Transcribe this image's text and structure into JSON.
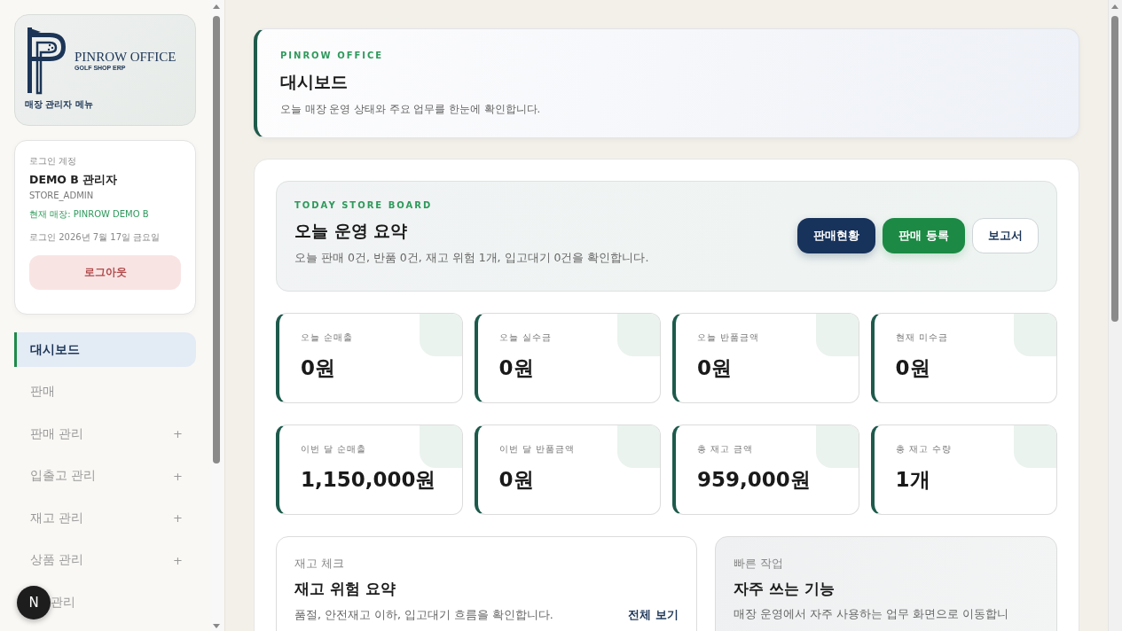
{
  "sidebar": {
    "logo": {
      "title": "PINROW OFFICE",
      "subtitle": "GOLF SHOP ERP",
      "caption": "매장 관리자 메뉴"
    },
    "account": {
      "label": "로그인 계정",
      "name": "DEMO B 관리자",
      "role": "STORE_ADMIN",
      "store": "현재 매장: PINROW DEMO B",
      "login_date": "로그인 2026년 7월 17일 금요일",
      "logout": "로그아웃"
    },
    "items": [
      {
        "label": "대시보드",
        "selected": true
      },
      {
        "label": "판매",
        "selected": false
      },
      {
        "label": "판매 관리",
        "selected": false,
        "toggle": "+"
      },
      {
        "label": "입출고 관리",
        "selected": false,
        "toggle": "+"
      },
      {
        "label": "재고 관리",
        "selected": false,
        "toggle": "+"
      },
      {
        "label": "상품 관리",
        "selected": false,
        "toggle": "+"
      },
      {
        "label": "관리",
        "selected": false,
        "covered": true
      }
    ],
    "floating_badge": "N"
  },
  "header": {
    "eyebrow": "PINROW OFFICE",
    "title": "대시보드",
    "description": "오늘 매장 운영 상태와 주요 업무를 한눈에 확인합니다."
  },
  "board": {
    "eyebrow": "TODAY STORE BOARD",
    "title": "오늘 운영 요약",
    "description": "오늘 판매 0건, 반품 0건, 재고 위험 1개, 입고대기 0건을 확인합니다.",
    "buttons": [
      {
        "label": "판매현황",
        "kind": "navy"
      },
      {
        "label": "판매 등록",
        "kind": "green"
      },
      {
        "label": "보고서",
        "kind": "outline"
      }
    ]
  },
  "stats": [
    {
      "label": "오늘 순매출",
      "value": "0원"
    },
    {
      "label": "오늘 실수금",
      "value": "0원"
    },
    {
      "label": "오늘 반품금액",
      "value": "0원"
    },
    {
      "label": "현재 미수금",
      "value": "0원"
    },
    {
      "label": "이번 달 순매출",
      "value": "1,150,000원"
    },
    {
      "label": "이번 달 반품금액",
      "value": "0원"
    },
    {
      "label": "총 재고 금액",
      "value": "959,000원"
    },
    {
      "label": "총 재고 수량",
      "value": "1개"
    }
  ],
  "panels": [
    {
      "eyebrow": "재고 체크",
      "title": "재고 위험 요약",
      "description": "품절, 안전재고 이하, 입고대기 흐름을 확인합니다.",
      "link": "전체 보기",
      "kind": "plain"
    },
    {
      "eyebrow": "빠른 작업",
      "title": "자주 쓰는 기능",
      "description": "매장 운영에서 자주 사용하는 업무 화면으로 이동합니",
      "kind": "tinted"
    }
  ]
}
